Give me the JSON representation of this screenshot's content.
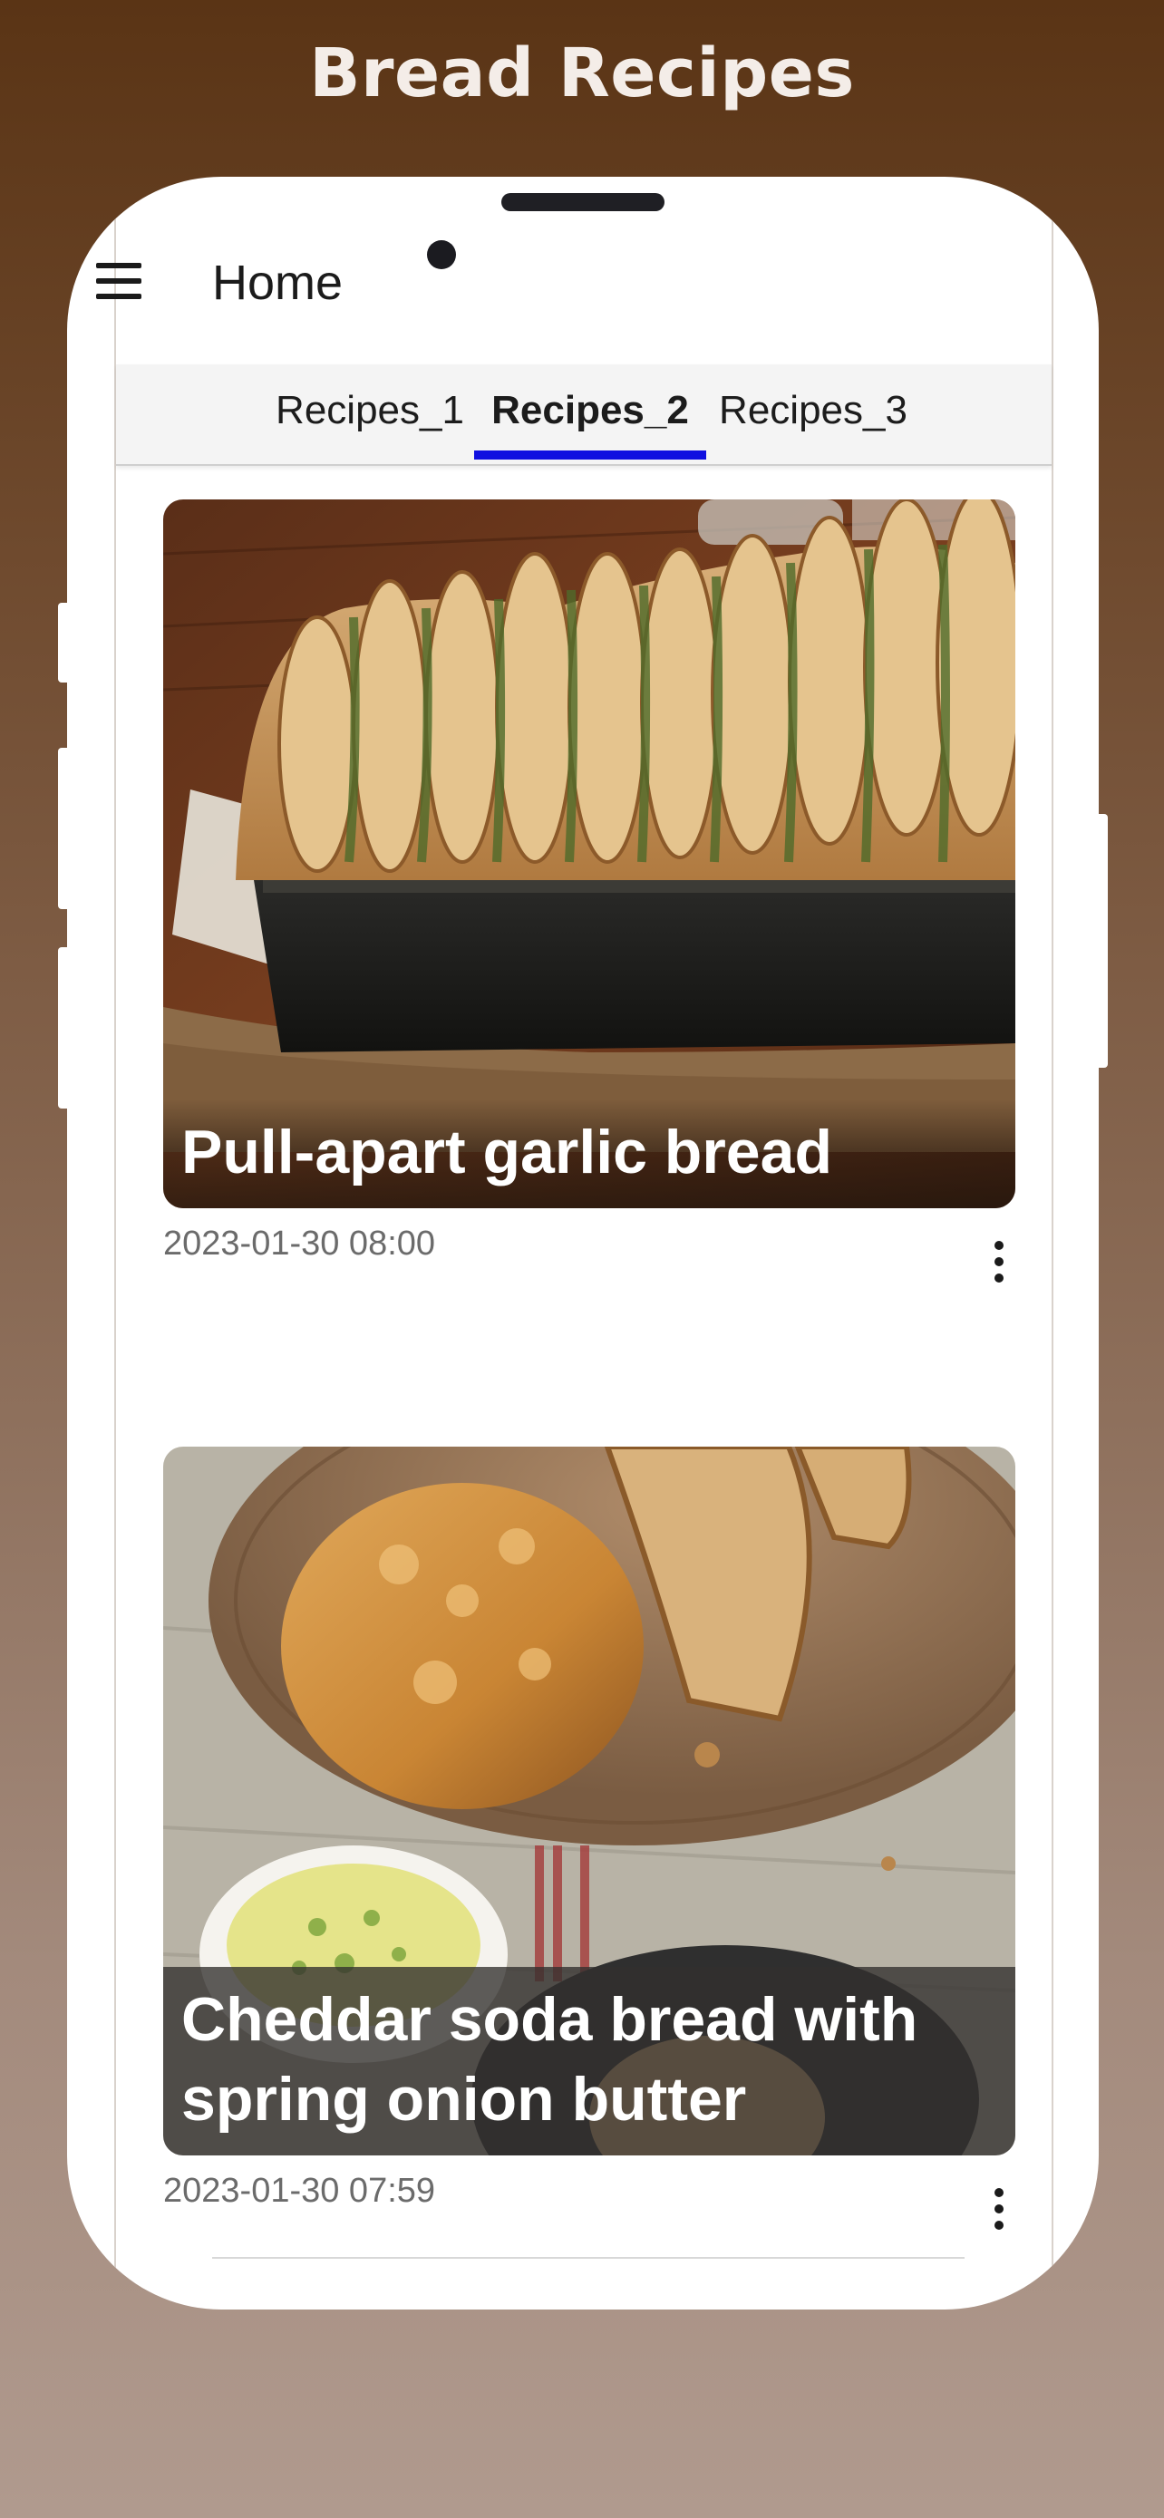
{
  "headline": "Bread Recipes",
  "app_bar": {
    "title": "Home",
    "menu_icon": "hamburger-menu-icon"
  },
  "tabs": [
    {
      "label": "Recipes_1",
      "active": false
    },
    {
      "label": "Recipes_2",
      "active": true
    },
    {
      "label": "Recipes_3",
      "active": false
    }
  ],
  "colors": {
    "tab_indicator": "#1010e0",
    "background_top": "#5a3415",
    "background_bottom": "#b09a8e"
  },
  "recipes": [
    {
      "title": "Pull-apart garlic bread",
      "date": "2023-01-30 08:00",
      "more_icon": "more-vertical-icon"
    },
    {
      "title": "Cheddar soda bread with spring onion butter",
      "date": "2023-01-30 07:59",
      "more_icon": "more-vertical-icon"
    }
  ]
}
